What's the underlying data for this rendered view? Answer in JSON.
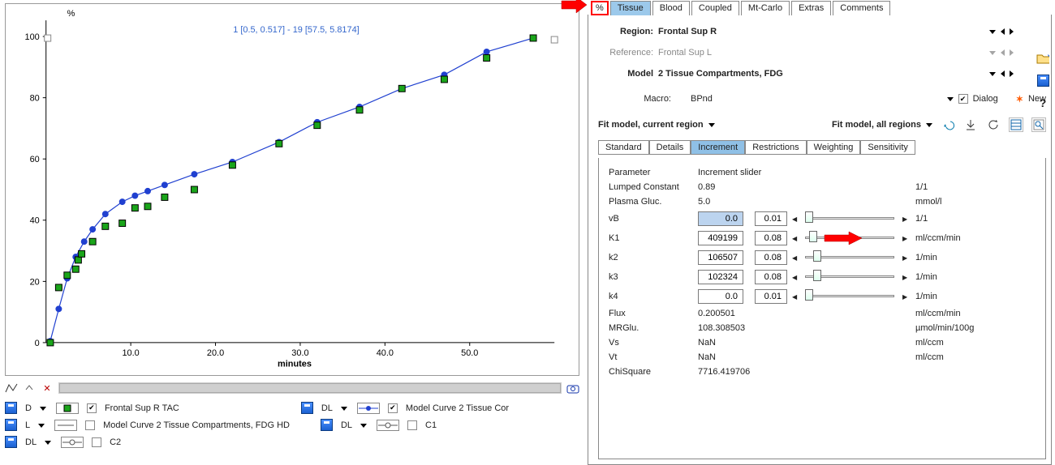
{
  "chart_data": {
    "type": "line",
    "title_note": "1 [0.5, 0.517] - 19 [57.5, 5.8174]",
    "xlabel": "minutes",
    "ylabel": "%",
    "xlim": [
      0,
      60
    ],
    "ylim": [
      0,
      110
    ],
    "xticks": [
      10.0,
      20.0,
      30.0,
      40.0,
      50.0
    ],
    "yticks": [
      0,
      20,
      40,
      60,
      80,
      100
    ],
    "series": [
      {
        "name": "Frontal Sup R TAC",
        "style": "green-square",
        "x": [
          0.5,
          1.5,
          2.5,
          3.5,
          3.8,
          4.2,
          5.5,
          7.0,
          9.0,
          10.5,
          12.0,
          14.0,
          17.5,
          22.0,
          27.5,
          32.0,
          37.0,
          42.0,
          47.0,
          52.0,
          57.5
        ],
        "y": [
          0,
          18,
          22,
          24,
          27,
          29,
          33,
          38,
          39,
          44,
          44.5,
          47.5,
          50,
          58,
          65,
          71,
          76,
          83,
          86,
          93,
          99.5
        ]
      },
      {
        "name": "Model Curve 2 Tissue Compartments, FDG HD",
        "style": "blue-line-circles",
        "x": [
          0.5,
          1.5,
          2.5,
          3.5,
          4.5,
          5.5,
          7.0,
          9.0,
          10.5,
          12.0,
          14.0,
          17.5,
          22.0,
          27.5,
          32.0,
          37.0,
          42.0,
          47.0,
          52.0,
          57.5
        ],
        "y": [
          0.5,
          11,
          21,
          28,
          33,
          37,
          42,
          46,
          48,
          49.5,
          51.5,
          55,
          59,
          65.5,
          72,
          77,
          83,
          87.5,
          95,
          99.5
        ]
      }
    ]
  },
  "tabs_main": {
    "pct": "%",
    "tissue": "Tissue",
    "blood": "Blood",
    "coupled": "Coupled",
    "mtcarlo": "Mt-Carlo",
    "extras": "Extras",
    "comments": "Comments",
    "active": "tissue"
  },
  "region_label": "Region:",
  "region_value": "Frontal Sup R",
  "reference_label": "Reference:",
  "reference_value": "Frontal Sup L",
  "model_label": "Model",
  "model_value": "2 Tissue Compartments, FDG",
  "macro_label": "Macro:",
  "macro_value": "BPnd",
  "dialog_label": "Dialog",
  "new_label": "New",
  "fit_current": "Fit model, current region",
  "fit_all": "Fit model, all regions",
  "subtabs": {
    "standard": "Standard",
    "details": "Details",
    "increment": "Increment",
    "restrictions": "Restrictions",
    "weighting": "Weighting",
    "sensitivity": "Sensitivity",
    "active": "increment"
  },
  "param_header": {
    "p": "Parameter",
    "s": "Increment slider"
  },
  "params": [
    {
      "name": "Lumped Constant",
      "v1": "0.89",
      "v2": "",
      "slider": null,
      "unit": "1/1"
    },
    {
      "name": "Plasma Gluc.",
      "v1": "5.0",
      "v2": "",
      "slider": null,
      "unit": "mmol/l"
    },
    {
      "name": "vB",
      "v1": "0.0",
      "v2": "0.01",
      "slider": 0,
      "unit": "1/1",
      "selected": true
    },
    {
      "name": "K1",
      "v1": "409199",
      "v2": "0.08",
      "slider": 5,
      "unit": "ml/ccm/min",
      "redArrow": true
    },
    {
      "name": "k2",
      "v1": "106507",
      "v2": "0.08",
      "slider": 10,
      "unit": "1/min"
    },
    {
      "name": "k3",
      "v1": "102324",
      "v2": "0.08",
      "slider": 10,
      "unit": "1/min"
    },
    {
      "name": "k4",
      "v1": "0.0",
      "v2": "0.01",
      "slider": 0,
      "unit": "1/min"
    }
  ],
  "results": [
    {
      "name": "Flux",
      "val": "0.200501",
      "unit": "ml/ccm/min"
    },
    {
      "name": "MRGlu.",
      "val": "108.308503",
      "unit": "µmol/min/100g"
    },
    {
      "name": "Vs",
      "val": "NaN",
      "unit": "ml/ccm"
    },
    {
      "name": "Vt",
      "val": "NaN",
      "unit": "ml/ccm"
    },
    {
      "name": "ChiSquare",
      "val": "7716.419706",
      "unit": ""
    }
  ],
  "legend": {
    "rows": [
      {
        "save": true,
        "code": "D",
        "sample": "green-sq",
        "chk": true,
        "label": "Frontal Sup R TAC"
      },
      {
        "save": true,
        "code": "L",
        "sample": "line",
        "chk": false,
        "label": "Model Curve 2 Tissue Compartments, FDG HD"
      },
      {
        "save": true,
        "code": "DL",
        "sample": "line-open-circ",
        "chk": false,
        "label": "C2"
      }
    ],
    "rowsB": [
      {
        "save": true,
        "code": "DL",
        "sample": "blue-circ-line",
        "chk": true,
        "label": "Model Curve 2 Tissue Cor"
      },
      {
        "save": true,
        "code": "DL",
        "sample": "line-open-circ",
        "chk": false,
        "label": "C1"
      }
    ]
  }
}
